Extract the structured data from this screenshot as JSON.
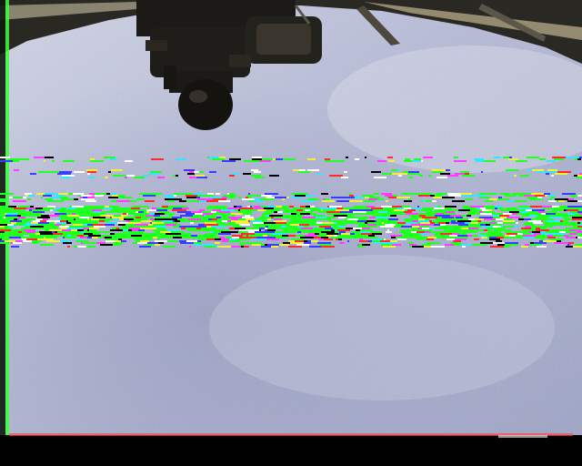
{
  "scene": {
    "colors": {
      "cloud_light": "#c9cde2",
      "cloud_mid": "#a9aed0",
      "cloud_dark": "#8a90b8",
      "structure": "#1b1a16",
      "structure_hi": "#5a5648",
      "panel_warm": "#b7ab8a",
      "bottom_bar": "#000000",
      "edge_green": "#3cff3c",
      "noise_green": "#22ff22",
      "noise_magenta": "#ff3cff",
      "noise_cyan": "#33e6ff",
      "noise_yellow": "#f3f038",
      "noise_red": "#ff2a2a",
      "noise_blue": "#3a3cff"
    },
    "icons": [
      "spacecraft-module-silhouette",
      "video-noise-band"
    ]
  }
}
